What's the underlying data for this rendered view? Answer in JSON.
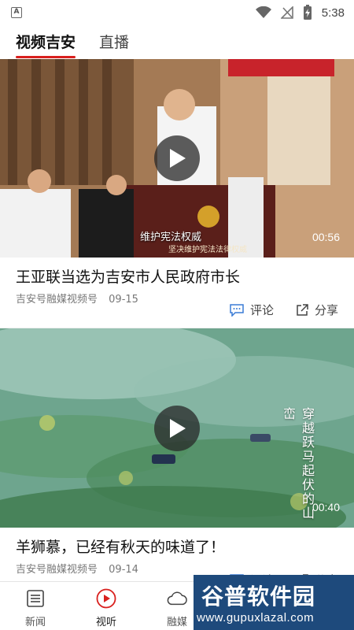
{
  "status_bar": {
    "time": "5:38",
    "app_icon_letter": "A"
  },
  "tabs": [
    {
      "label": "视频吉安",
      "active": true
    },
    {
      "label": "直播",
      "active": false
    }
  ],
  "cards": [
    {
      "title": "王亚联当选为吉安市人民政府市长",
      "source": "吉安号融媒视频号",
      "date": "09-15",
      "duration": "00:56",
      "caption": "维护宪法权威",
      "caption_sub": "坚决维护宪法法律权威",
      "comment_label": "评论",
      "share_label": "分享"
    },
    {
      "title": "羊狮慕，已经有秋天的味道了！",
      "source": "吉安号融媒视频号",
      "date": "09-14",
      "duration": "00:40",
      "overlay_text": "穿越跃马起伏的山峦",
      "comment_label": "评论",
      "share_label": "分享"
    }
  ],
  "bottom_nav": [
    {
      "label": "新闻",
      "icon": "list-icon",
      "active": false
    },
    {
      "label": "视听",
      "icon": "play-circle-icon",
      "active": true
    },
    {
      "label": "融媒",
      "icon": "cloud-icon",
      "active": false
    }
  ],
  "watermark": {
    "text": "谷普软件园",
    "url": "www.gupuxlazal.com"
  },
  "colors": {
    "accent": "#d9201e",
    "watermark_bg": "#1e4a7c"
  }
}
